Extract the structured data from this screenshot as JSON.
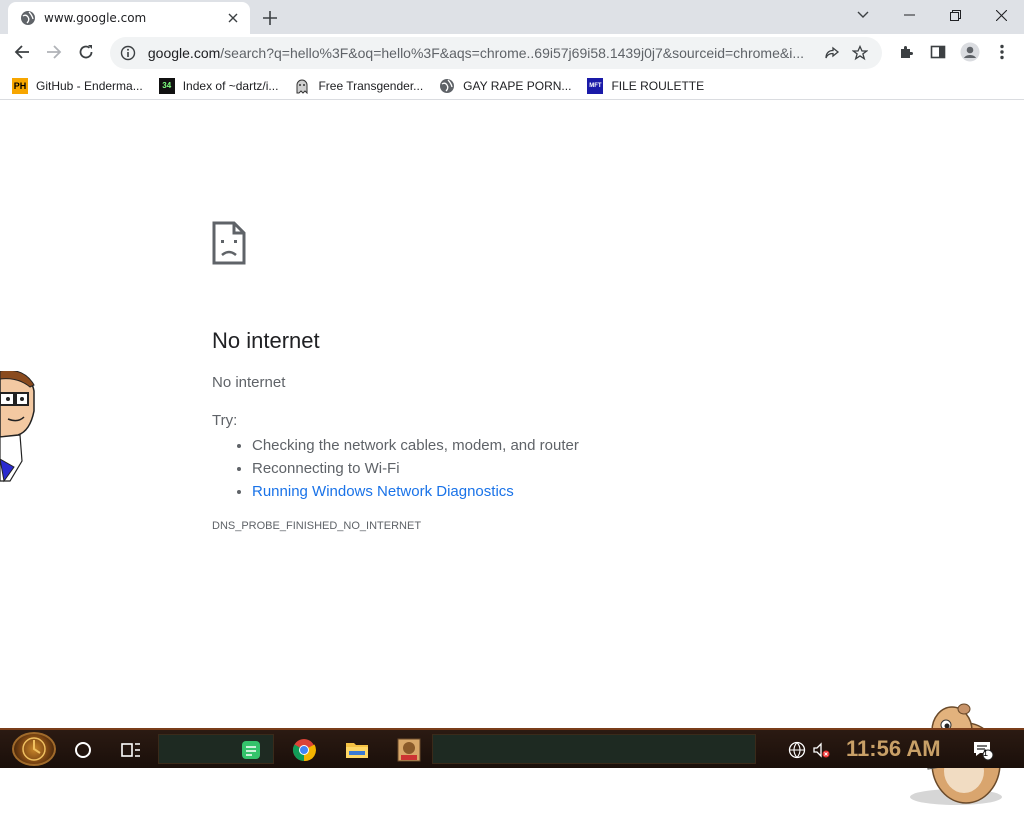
{
  "tab": {
    "title": "www.google.com",
    "favicon": "globe-icon"
  },
  "toolbar": {
    "url_main": "google.com",
    "url_rest": "/search?q=hello%3F&oq=hello%3F&aqs=chrome..69i57j69i58.1439j0j7&sourceid=chrome&i..."
  },
  "bookmarks": [
    {
      "label": "GitHub - Enderma...",
      "icon": "PH"
    },
    {
      "label": "Index of ~dartz/i...",
      "icon": "34"
    },
    {
      "label": "Free Transgender...",
      "icon": "ghost"
    },
    {
      "label": "GAY RAPE PORN...",
      "icon": "globe"
    },
    {
      "label": "FILE ROULETTE",
      "icon": "MFT"
    }
  ],
  "error": {
    "heading": "No internet",
    "subtitle": "No internet",
    "try_label": "Try:",
    "suggestions": [
      "Checking the network cables, modem, and router",
      "Reconnecting to Wi-Fi"
    ],
    "diagnostics_link": "Running Windows Network Diagnostics",
    "code": "DNS_PROBE_FINISHED_NO_INTERNET"
  },
  "taskbar": {
    "clock": "11:56 AM",
    "notification_count": "1"
  },
  "colors": {
    "accent": "#1a73e8",
    "tabstrip": "#dee1e6",
    "clock": "#c9a067"
  }
}
